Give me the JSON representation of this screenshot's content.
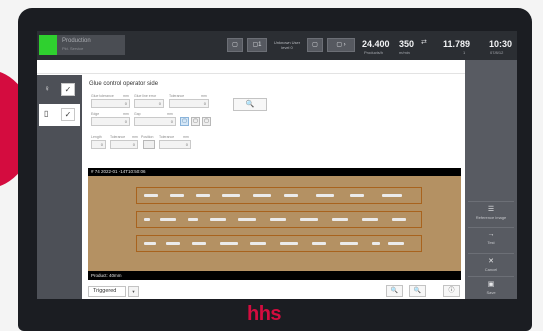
{
  "header": {
    "status_title": "Production",
    "status_sub": "Pkt. Service",
    "status_color": "#2fd02f",
    "btn_a": "▢",
    "btn_b": "▢1",
    "user_label": "Unknown User level 0",
    "btn_c": "▢",
    "btn_d": "▢ ›",
    "stats": [
      {
        "value": "24.400",
        "label": "Products/h"
      },
      {
        "value": "350",
        "label": "m/min"
      },
      {
        "value": "11.789",
        "label": "1"
      },
      {
        "value": "10:30",
        "label": "07/8/12"
      }
    ]
  },
  "nav": {
    "items": [
      {
        "icon": "bulb-icon",
        "glyph": "♀",
        "check": "✓"
      },
      {
        "icon": "document-icon",
        "glyph": "▯",
        "check": "✓"
      }
    ]
  },
  "form": {
    "title": "Glue control operator side",
    "labels": {
      "glue_tolerance": "Glue tolerance",
      "glue_tolerance_unit": "mm",
      "glue_line_error": "Glue line error",
      "tolerance_1": "Tolerance",
      "tolerance_1_unit": "mm",
      "edge": "Edge",
      "edge_unit": "mm",
      "gap": "Gap",
      "gap_unit": "mm",
      "length": "Length",
      "tolerance_2": "Tolerance",
      "tolerance_2_unit": "mm",
      "position": "Position",
      "tolerance_3": "Tolerance",
      "tolerance_3_unit": "mm"
    },
    "values": {
      "glue_tolerance": "0",
      "glue_line_error": "0",
      "tolerance_1": "0",
      "edge": "0",
      "gap": "0",
      "length": "0",
      "tolerance_2": "0",
      "tolerance_3": "0"
    },
    "edge_buttons": [
      "▢",
      "▢",
      "▢"
    ],
    "search_glyph": "🔍"
  },
  "image": {
    "timestamp": "# 74 2022-01 -14T10:50:06",
    "product": "Product: 40mm",
    "board_color": "#b49163"
  },
  "footer": {
    "trigger_value": "Triggered",
    "trigger_dd": "▼",
    "zoom_in": "🔍",
    "zoom_out": "🔍",
    "info": "ⓘ"
  },
  "rightpanel": {
    "buttons": [
      {
        "icon": "grid-icon",
        "glyph": "☰",
        "label": "Reference image"
      },
      {
        "icon": "arrow-right-icon",
        "glyph": "→",
        "label": "Test"
      },
      {
        "icon": "close-icon",
        "glyph": "✕",
        "label": "Cancel"
      },
      {
        "icon": "save-icon",
        "glyph": "▣",
        "label": "Save"
      }
    ]
  },
  "logo": {
    "text": "hhs",
    "color": "#d40c3f"
  }
}
